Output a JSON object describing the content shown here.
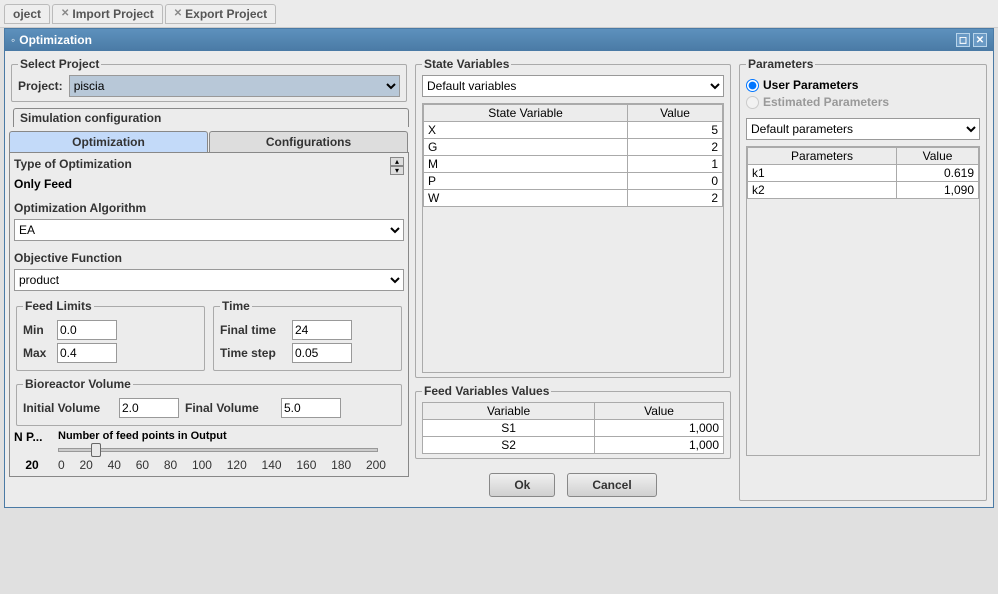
{
  "topbar": {
    "items": [
      "oject",
      "Import Project",
      "Export Project"
    ]
  },
  "window": {
    "title": "Optimization"
  },
  "selectProject": {
    "legend": "Select Project",
    "label": "Project:",
    "value": "piscia"
  },
  "simConfigLabel": "Simulation configuration",
  "tabs": {
    "optimization": "Optimization",
    "configurations": "Configurations"
  },
  "optType": {
    "label": "Type of Optimization",
    "value": "Only Feed"
  },
  "algo": {
    "label": "Optimization Algorithm",
    "value": "EA"
  },
  "objective": {
    "label": "Objective Function",
    "value": "product"
  },
  "feedLimits": {
    "legend": "Feed Limits",
    "minLabel": "Min",
    "min": "0.0",
    "maxLabel": "Max",
    "max": "0.4"
  },
  "time": {
    "legend": "Time",
    "finalLabel": "Final time",
    "final": "24",
    "stepLabel": "Time step",
    "step": "0.05"
  },
  "bioreactor": {
    "legend": "Bioreactor Volume",
    "initLabel": "Initial Volume",
    "init": "2.0",
    "finalLabel": "Final Volume",
    "final": "5.0"
  },
  "slider": {
    "npLabel": "N P...",
    "label": "Number of feed points in Output",
    "value": "20",
    "ticks": [
      "0",
      "20",
      "40",
      "60",
      "80",
      "100",
      "120",
      "140",
      "160",
      "180",
      "200"
    ]
  },
  "stateVars": {
    "legend": "State Variables",
    "dropdown": "Default variables",
    "headers": {
      "var": "State Variable",
      "val": "Value"
    },
    "rows": [
      {
        "v": "X",
        "val": "5"
      },
      {
        "v": "G",
        "val": "2"
      },
      {
        "v": "M",
        "val": "1"
      },
      {
        "v": "P",
        "val": "0"
      },
      {
        "v": "W",
        "val": "2"
      }
    ]
  },
  "feedVars": {
    "legend": "Feed Variables Values",
    "headers": {
      "var": "Variable",
      "val": "Value"
    },
    "rows": [
      {
        "v": "S1",
        "val": "1,000"
      },
      {
        "v": "S2",
        "val": "1,000"
      }
    ]
  },
  "params": {
    "legend": "Parameters",
    "userLabel": "User Parameters",
    "estLabel": "Estimated Parameters",
    "dropdown": "Default parameters",
    "headers": {
      "p": "Parameters",
      "val": "Value"
    },
    "rows": [
      {
        "p": "k1",
        "val": "0.619"
      },
      {
        "p": "k2",
        "val": "1,090"
      }
    ]
  },
  "buttons": {
    "ok": "Ok",
    "cancel": "Cancel"
  }
}
